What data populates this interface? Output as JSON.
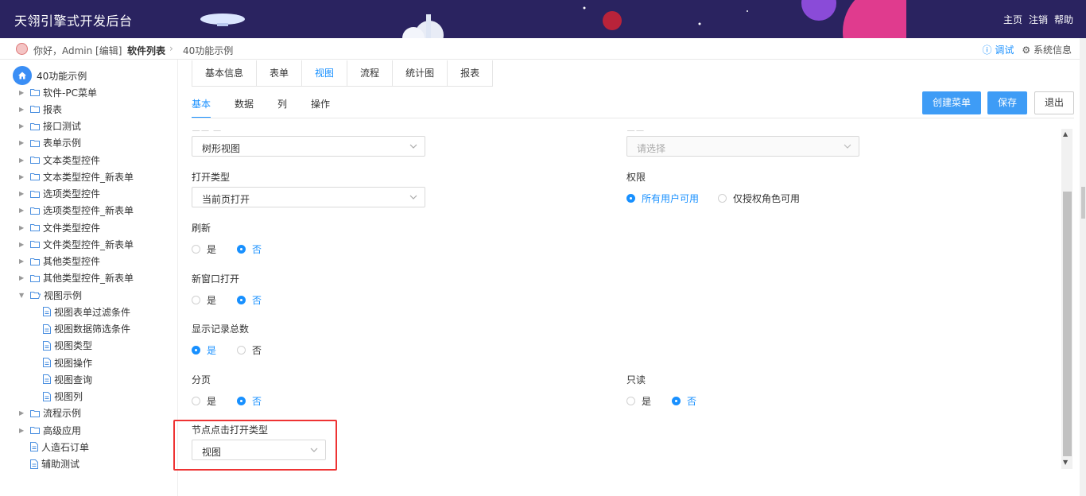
{
  "header": {
    "title": "天翎引擎式开发后台",
    "nav": [
      "主页",
      "注销",
      "帮助"
    ]
  },
  "crumbbar": {
    "greeting": "你好，Admin [编辑]",
    "crumb1": "软件列表",
    "crumb2": "40功能示例",
    "debug": "调试",
    "sysinfo": "系统信息"
  },
  "tree": {
    "root": "40功能示例",
    "items": [
      {
        "label": "软件-PC菜单",
        "type": "folder"
      },
      {
        "label": "报表",
        "type": "folder"
      },
      {
        "label": "接口测试",
        "type": "folder"
      },
      {
        "label": "表单示例",
        "type": "folder"
      },
      {
        "label": "文本类型控件",
        "type": "folder"
      },
      {
        "label": "文本类型控件_新表单",
        "type": "folder"
      },
      {
        "label": "选项类型控件",
        "type": "folder"
      },
      {
        "label": "选项类型控件_新表单",
        "type": "folder"
      },
      {
        "label": "文件类型控件",
        "type": "folder"
      },
      {
        "label": "文件类型控件_新表单",
        "type": "folder"
      },
      {
        "label": "其他类型控件",
        "type": "folder"
      },
      {
        "label": "其他类型控件_新表单",
        "type": "folder"
      },
      {
        "label": "视图示例",
        "type": "folder-open"
      },
      {
        "label": "视图表单过滤条件",
        "type": "file"
      },
      {
        "label": "视图数据筛选条件",
        "type": "file"
      },
      {
        "label": "视图类型",
        "type": "file"
      },
      {
        "label": "视图操作",
        "type": "file"
      },
      {
        "label": "视图查询",
        "type": "file"
      },
      {
        "label": "视图列",
        "type": "file"
      },
      {
        "label": "流程示例",
        "type": "folder"
      },
      {
        "label": "高级应用",
        "type": "folder"
      },
      {
        "label": "人造石订单",
        "type": "file-root"
      },
      {
        "label": "辅助测试",
        "type": "file-root"
      }
    ]
  },
  "tabs": [
    "基本信息",
    "表单",
    "视图",
    "流程",
    "统计图",
    "报表"
  ],
  "subtabs": [
    "基本",
    "数据",
    "列",
    "操作"
  ],
  "buttons": {
    "create_menu": "创建菜单",
    "save": "保存",
    "exit": "退出"
  },
  "form": {
    "view_style_value": "树形视图",
    "top_right_placeholder": "请选择",
    "open_type_label": "打开类型",
    "open_type_value": "当前页打开",
    "permission_label": "权限",
    "permission_options": [
      "所有用户可用",
      "仅授权角色可用"
    ],
    "refresh_label": "刷新",
    "new_window_label": "新窗口打开",
    "show_total_label": "显示记录总数",
    "paging_label": "分页",
    "readonly_label": "只读",
    "yes": "是",
    "no": "否",
    "node_click_label": "节点点击打开类型",
    "node_click_value": "视图"
  },
  "colors": {
    "header_bg": "#2a2360",
    "accent": "#1890ff",
    "primary_button": "#3e9cf6",
    "highlight": "#e33333"
  }
}
